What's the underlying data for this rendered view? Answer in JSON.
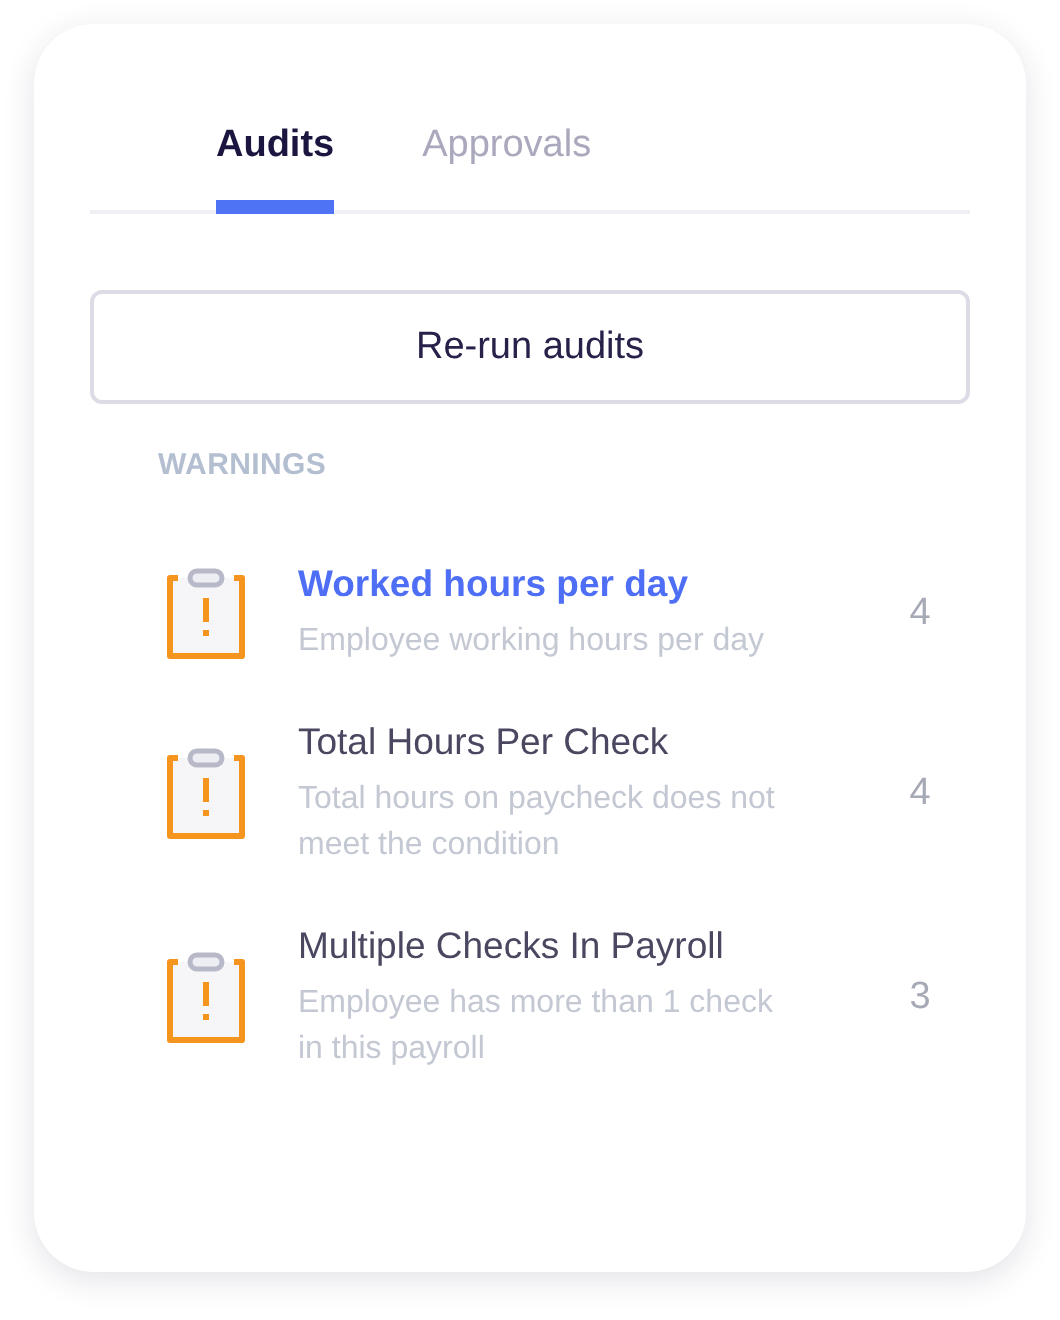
{
  "tabs": [
    {
      "label": "Audits",
      "selected": true
    },
    {
      "label": "Approvals",
      "selected": false
    }
  ],
  "rerun_button": "Re-run audits",
  "section_title": "WARNINGS",
  "warnings": [
    {
      "title": "Worked hours per day",
      "description": "Employee working hours per day",
      "count": "4",
      "selected": true
    },
    {
      "title": "Total Hours Per Check",
      "description": "Total hours on paycheck does not meet the condition",
      "count": "4",
      "selected": false
    },
    {
      "title": "Multiple Checks In Payroll",
      "description": "Employee has more than 1 check in this payroll",
      "count": "3",
      "selected": false
    }
  ]
}
